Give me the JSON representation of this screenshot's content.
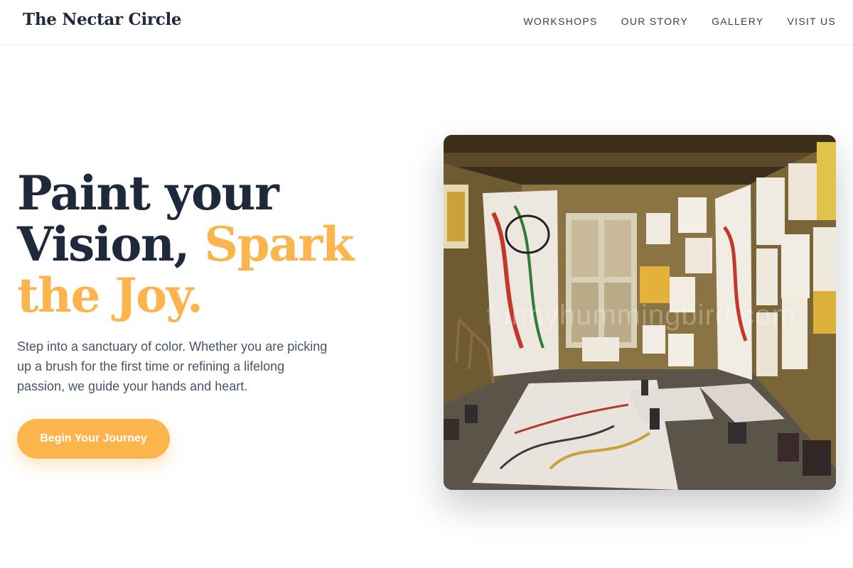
{
  "header": {
    "brand": "The Nectar Circle",
    "nav": [
      "WORKSHOPS",
      "OUR STORY",
      "GALLERY",
      "VISIT US"
    ]
  },
  "hero": {
    "title_line1": "Paint your",
    "title_line2_plain": "Vision, ",
    "title_line2_accent": "Spark",
    "title_line3_accent": "the Joy.",
    "description": "Step into a sanctuary of color. Whether you are picking up a brush for the first time or refining a lifelong passion, we guide your hands and heart.",
    "cta_label": "Begin Your Journey",
    "image_watermark": "funnyhummingbird.com"
  },
  "colors": {
    "accent": "#fbb54c",
    "heading": "#1e293b",
    "body_text": "#475569"
  }
}
